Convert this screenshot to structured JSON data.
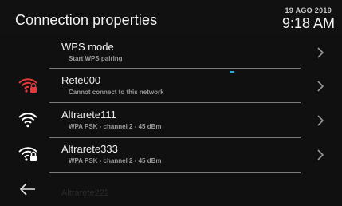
{
  "header": {
    "title": "Connection properties",
    "date": "19 AGO 2019",
    "time": "9:18 AM"
  },
  "list": [
    {
      "name": "WPS mode",
      "subtitle": "Start WPS pairing",
      "icon": "none"
    },
    {
      "name": "Rete000",
      "subtitle": "Cannot connect to this network",
      "icon": "wifi-locked-error-icon",
      "icon_color": "#e23a3a"
    },
    {
      "name": "Altrarete111",
      "subtitle": "WPA PSK - channel 2 - 45 dBm",
      "icon": "wifi-icon",
      "icon_color": "#ffffff"
    },
    {
      "name": "Altrarete333",
      "subtitle": "WPA PSK - channel 2 - 45 dBm",
      "icon": "wifi-locked-icon",
      "icon_color": "#ffffff"
    }
  ],
  "partial_next_item": "Altrarete222",
  "footer": {
    "back_icon": "back-arrow-icon"
  },
  "colors": {
    "background": "#101010",
    "divider": "#7a7a7a",
    "error": "#e23a3a",
    "accent": "#2aa9e0"
  }
}
